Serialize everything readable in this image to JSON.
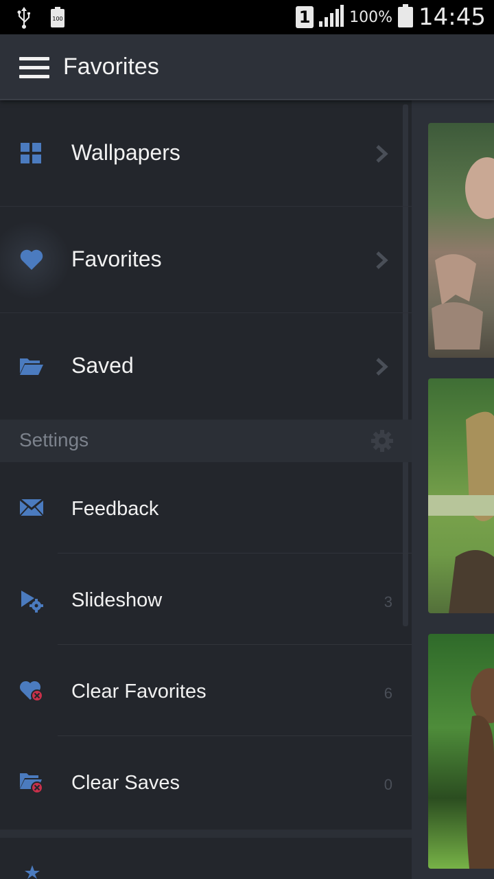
{
  "status_bar": {
    "sim_slot": "1",
    "battery_percent": "100%",
    "time": "14:45",
    "battery_small_label": "100"
  },
  "app_bar": {
    "title": "Favorites"
  },
  "drawer": {
    "nav_items": [
      {
        "label": "Wallpapers",
        "icon": "grid-icon"
      },
      {
        "label": "Favorites",
        "icon": "heart-icon",
        "active": true
      },
      {
        "label": "Saved",
        "icon": "folder-open-icon"
      }
    ],
    "settings": {
      "header": "Settings",
      "items": [
        {
          "label": "Feedback",
          "icon": "envelope-icon",
          "count": ""
        },
        {
          "label": "Slideshow",
          "icon": "play-gear-icon",
          "count": "3"
        },
        {
          "label": "Clear Favorites",
          "icon": "heart-remove-icon",
          "count": "6"
        },
        {
          "label": "Clear Saves",
          "icon": "folder-remove-icon",
          "count": "0"
        }
      ]
    }
  },
  "colors": {
    "accent": "#4b7bbf",
    "drawer_bg": "#23262c",
    "app_bar_bg": "#2d3139"
  }
}
